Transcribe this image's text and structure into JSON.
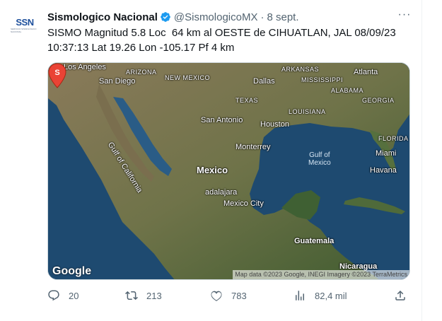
{
  "account": {
    "avatar_text_main": "SSN",
    "avatar_text_sub": "SERVICIO SISMOLÓGICO NACIONAL",
    "name": "Sismologico Nacional",
    "handle": "@SismologicoMX",
    "separator": "·",
    "date": "8 sept."
  },
  "tweet": {
    "text": "SISMO Magnitud 5.8 Loc  64 km al OESTE de CIHUATLAN, JAL 08/09/23\n10:37:13 Lat 19.26 Lon -105.17 Pf 4 km"
  },
  "map": {
    "labels": {
      "los_angeles": "Los Angeles",
      "san_diego": "San Diego",
      "arizona": "ARIZONA",
      "new_mexico": "NEW MEXICO",
      "arkansas": "ARKANSAS",
      "atlanta": "Atlanta",
      "dallas": "Dallas",
      "mississippi": "MISSISSIPPI",
      "alabama": "ALABAMA",
      "georgia": "GEORGIA",
      "texas": "TEXAS",
      "louisiana": "LOUISIANA",
      "san_antonio": "San Antonio",
      "houston": "Houston",
      "gulf_of_california": "Gulf of California",
      "florida": "FLORIDA",
      "monterrey": "Monterrey",
      "miami": "Miami",
      "gulf_of_mexico": "Gulf of\nMexico",
      "mexico": "Mexico",
      "havana": "Havana",
      "guadalajara": "adalajara",
      "mexico_city": "Mexico City",
      "guatemala": "Guatemala",
      "nicaragua": "Nicaragua"
    },
    "pin_letter": "S",
    "google": "Google",
    "attribution": "Map data ©2023 Google, INEGI Imagery ©2023 TerraMetrics"
  },
  "actions": {
    "replies": "20",
    "retweets": "213",
    "likes": "783",
    "views": "82,4 mil"
  },
  "colors": {
    "verified": "#1d9bf0",
    "pin": "#ea4335",
    "text_secondary": "#536471"
  }
}
